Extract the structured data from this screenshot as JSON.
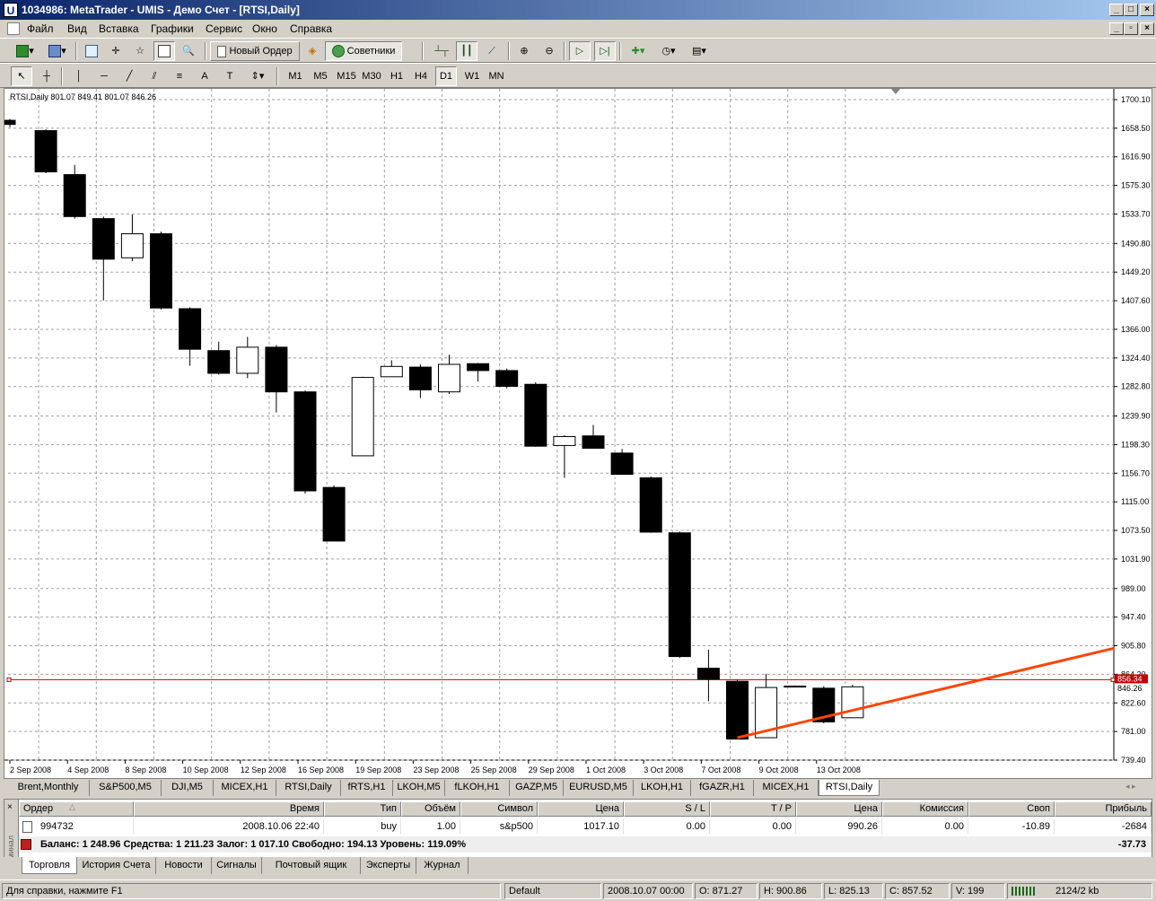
{
  "window": {
    "title": "1034986: MetaTrader - UMIS - Демо Счет - [RTSI,Daily]"
  },
  "menu": [
    "Файл",
    "Вид",
    "Вставка",
    "Графики",
    "Сервис",
    "Окно",
    "Справка"
  ],
  "toolbar": {
    "new_order": "Новый Ордер",
    "experts": "Советники"
  },
  "timeframes": [
    "M1",
    "M5",
    "M15",
    "M30",
    "H1",
    "H4",
    "D1",
    "W1",
    "MN"
  ],
  "active_timeframe": "D1",
  "chart": {
    "header": "RTSI,Daily  801.07 849.41 801.07 846.26",
    "price_label_a": "856.34",
    "price_label_b": "846.26"
  },
  "chart_data": {
    "type": "candlestick",
    "symbol": "RTSI",
    "timeframe": "Daily",
    "ylim": [
      739.4,
      1700.1
    ],
    "y_ticks": [
      1700.1,
      1658.5,
      1616.9,
      1575.3,
      1533.7,
      1490.8,
      1449.2,
      1407.6,
      1366.0,
      1324.4,
      1282.8,
      1239.9,
      1198.3,
      1156.7,
      1115.0,
      1073.5,
      1031.9,
      989.0,
      947.4,
      905.8,
      864.2,
      822.6,
      781.0,
      739.4
    ],
    "y_tick_labels": [
      "1700.10",
      "1658.50",
      "1616.90",
      "1575.30",
      "1533.70",
      "1490.80",
      "1449.20",
      "1407.60",
      "1366.00",
      "1324.40",
      "1282.80",
      "1239.90",
      "1198.30",
      "1156.70",
      "1115.00",
      "1073.50",
      "1031.90",
      "989.00",
      "947.40",
      "905.80",
      "864.20",
      "822.60",
      "781.00",
      "739.40"
    ],
    "x_labels": [
      "2 Sep 2008",
      "4 Sep 2008",
      "8 Sep 2008",
      "10 Sep 2008",
      "12 Sep 2008",
      "16 Sep 2008",
      "19 Sep 2008",
      "23 Sep 2008",
      "25 Sep 2008",
      "29 Sep 2008",
      "1 Oct 2008",
      "3 Oct 2008",
      "7 Oct 2008",
      "9 Oct 2008",
      "13 Oct 2008"
    ],
    "candles": [
      {
        "o": 1670,
        "h": 1672,
        "l": 1660,
        "c": 1664
      },
      {
        "o": 1655,
        "h": 1657,
        "l": 1593,
        "c": 1595
      },
      {
        "o": 1591,
        "h": 1605,
        "l": 1527,
        "c": 1530
      },
      {
        "o": 1527,
        "h": 1530,
        "l": 1408,
        "c": 1468
      },
      {
        "o": 1470,
        "h": 1533,
        "l": 1465,
        "c": 1505
      },
      {
        "o": 1505,
        "h": 1508,
        "l": 1395,
        "c": 1397
      },
      {
        "o": 1396,
        "h": 1398,
        "l": 1313,
        "c": 1337
      },
      {
        "o": 1335,
        "h": 1348,
        "l": 1300,
        "c": 1302
      },
      {
        "o": 1302,
        "h": 1355,
        "l": 1295,
        "c": 1340
      },
      {
        "o": 1340,
        "h": 1343,
        "l": 1245,
        "c": 1275
      },
      {
        "o": 1275,
        "h": 1277,
        "l": 1127,
        "c": 1131
      },
      {
        "o": 1136,
        "h": 1139,
        "l": 1058,
        "c": 1058
      },
      {
        "o": 1182,
        "h": 1297,
        "l": 1182,
        "c": 1296
      },
      {
        "o": 1297,
        "h": 1321,
        "l": 1297,
        "c": 1312
      },
      {
        "o": 1311,
        "h": 1315,
        "l": 1266,
        "c": 1278
      },
      {
        "o": 1275,
        "h": 1329,
        "l": 1272,
        "c": 1315
      },
      {
        "o": 1316,
        "h": 1317,
        "l": 1290,
        "c": 1306
      },
      {
        "o": 1306,
        "h": 1309,
        "l": 1280,
        "c": 1283
      },
      {
        "o": 1286,
        "h": 1289,
        "l": 1195,
        "c": 1196
      },
      {
        "o": 1197,
        "h": 1212,
        "l": 1150,
        "c": 1210
      },
      {
        "o": 1211,
        "h": 1227,
        "l": 1193,
        "c": 1193
      },
      {
        "o": 1186,
        "h": 1192,
        "l": 1155,
        "c": 1155
      },
      {
        "o": 1150,
        "h": 1152,
        "l": 1070,
        "c": 1071
      },
      {
        "o": 1070,
        "h": 1072,
        "l": 888,
        "c": 890
      },
      {
        "o": 873,
        "h": 900,
        "l": 825,
        "c": 857
      },
      {
        "o": 854,
        "h": 856,
        "l": 770,
        "c": 770
      },
      {
        "o": 772,
        "h": 865,
        "l": 772,
        "c": 845
      },
      {
        "o": 846,
        "h": 848,
        "l": 845,
        "c": 847
      },
      {
        "o": 844,
        "h": 847,
        "l": 793,
        "c": 795
      },
      {
        "o": 801,
        "h": 849,
        "l": 801,
        "c": 846
      }
    ],
    "trendline": {
      "from": {
        "index": 25,
        "price": 772
      },
      "to": {
        "price": 902
      },
      "color": "#ff4400"
    },
    "horizontal_line": {
      "price": 856.34,
      "color": "#c00000"
    }
  },
  "chart_tabs": [
    "Brent,Monthly",
    "S&P500,M5",
    "DJI,M5",
    "MICEX,H1",
    "RTSI,Daily",
    "fRTS,H1",
    "LKOH,M5",
    "fLKOH,H1",
    "GAZP,M5",
    "EURUSD,M5",
    "LKOH,H1",
    "fGAZR,H1",
    "MICEX,H1",
    "RTSI,Daily"
  ],
  "active_chart_tab": 13,
  "terminal": {
    "side_label": "Терминал",
    "columns": [
      "Ордер",
      "Время",
      "Тип",
      "Объём",
      "Символ",
      "Цена",
      "S / L",
      "T / P",
      "Цена",
      "Комиссия",
      "Своп",
      "Прибыль"
    ],
    "order": {
      "id": "994732",
      "time": "2008.10.06 22:40",
      "type": "buy",
      "volume": "1.00",
      "symbol": "s&p500",
      "open_price": "1017.10",
      "sl": "0.00",
      "tp": "0.00",
      "price": "990.26",
      "commission": "0.00",
      "swap": "-10.89",
      "profit": "-2684"
    },
    "balance_line": "Баланс: 1 248.96  Средства: 1 211.23  Залог: 1 017.10  Свободно: 194.13  Уровень: 119.09%",
    "balance_profit": "-37.73",
    "tabs": [
      "Торговля",
      "История Счета",
      "Новости",
      "Сигналы",
      "Почтовый ящик",
      "Эксперты",
      "Журнал"
    ],
    "active_tab": "Торговля"
  },
  "status": {
    "help": "Для справки, нажмите F1",
    "profile": "Default",
    "datetime": "2008.10.07 00:00",
    "open": "O: 871.27",
    "high": "H: 900.86",
    "low": "L: 825.13",
    "close": "C: 857.52",
    "volume": "V: 199",
    "traffic": "2124/2 kb"
  },
  "colors": {
    "trendline": "#ff4400",
    "hline": "#c00000",
    "title_bg": "#0a246a"
  }
}
